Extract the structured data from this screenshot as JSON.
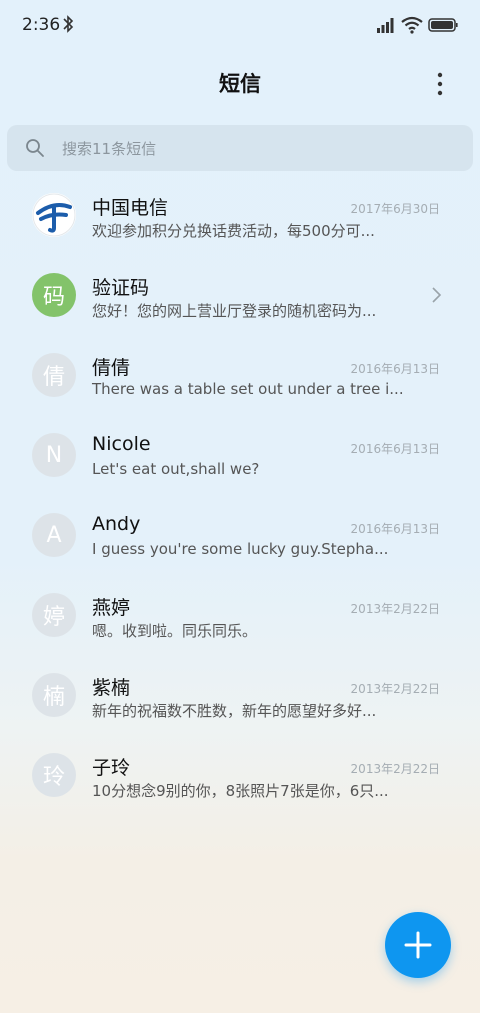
{
  "status_bar": {
    "time": "2:36"
  },
  "header": {
    "title": "短信"
  },
  "search": {
    "placeholder": "搜索11条短信"
  },
  "conversations": [
    {
      "avatar": "",
      "name": "中国电信",
      "date": "2017年6月30日",
      "preview": "欢迎参加积分兑换话费活动，每500分可..."
    },
    {
      "avatar": "码",
      "name": "验证码",
      "date": "",
      "preview": "您好！您的网上营业厅登录的随机密码为..."
    },
    {
      "avatar": "倩",
      "name": "倩倩",
      "date": "2016年6月13日",
      "preview": "There was a table set out under a tree i..."
    },
    {
      "avatar": "N",
      "name": "Nicole",
      "date": "2016年6月13日",
      "preview": "Let's eat out,shall we?"
    },
    {
      "avatar": "A",
      "name": "Andy",
      "date": "2016年6月13日",
      "preview": "I guess you're some lucky guy.Stepha..."
    },
    {
      "avatar": "婷",
      "name": "燕婷",
      "date": "2013年2月22日",
      "preview": "嗯。收到啦。同乐同乐。"
    },
    {
      "avatar": "楠",
      "name": "紫楠",
      "date": "2013年2月22日",
      "preview": "新年的祝福数不胜数，新年的愿望好多好..."
    },
    {
      "avatar": "玲",
      "name": "子玲",
      "date": "2013年2月22日",
      "preview": "10分想念9别的你，8张照片7张是你，6只..."
    }
  ],
  "colors": {
    "accent": "#0e96f0",
    "group_avatar": "#83c36a",
    "avatar_gray": "#dde3e8"
  },
  "icons": [
    "bluetooth-icon",
    "signal-icon",
    "wifi-icon",
    "battery-icon",
    "more-vertical-icon",
    "search-icon",
    "chevron-right-icon",
    "plus-icon",
    "china-telecom-logo"
  ]
}
